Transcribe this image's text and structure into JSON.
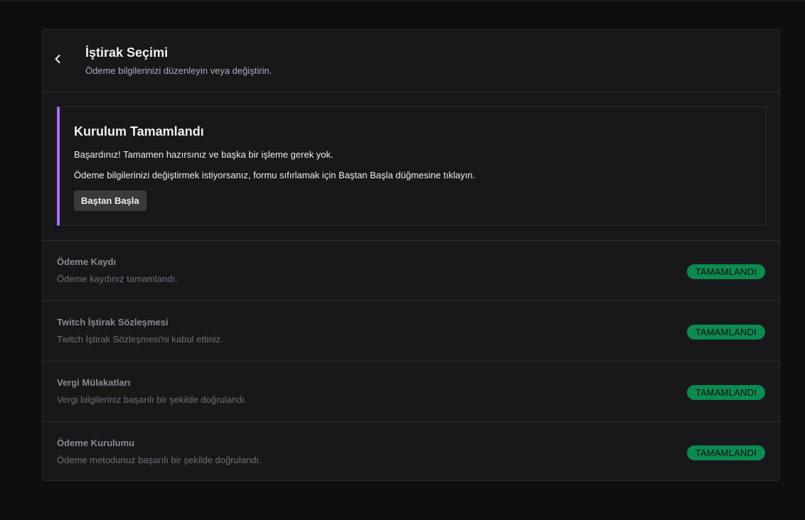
{
  "header": {
    "title": "İştirak Seçimi",
    "subtitle": "Ödeme bilgilerinizi düzenleyin veya değiştirin.",
    "back_icon": "chevron-left-icon"
  },
  "notice": {
    "title": "Kurulum Tamamlandı",
    "line1": "Başardınız! Tamamen hazırsınız ve başka bir işleme gerek yok.",
    "line2": "Ödeme bilgilerinizi değiştirmek istiyorsanız, formu sıfırlamak için Baştan Başla düğmesine tıklayın.",
    "button_label": "Baştan Başla",
    "accent_color": "#a970ff"
  },
  "steps": [
    {
      "title": "Ödeme Kaydı",
      "description": "Ödeme kaydınız tamamlandı.",
      "status": "TAMAMLANDI"
    },
    {
      "title": "Twitch İştirak Sözleşmesi",
      "description": "Twitch İştirak Sözleşmesi'ni kabul ettiniz.",
      "status": "TAMAMLANDI"
    },
    {
      "title": "Vergi Mülakatları",
      "description": "Vergi bilgileriniz başarılı bir şekilde doğrulandı.",
      "status": "TAMAMLANDI"
    },
    {
      "title": "Ödeme Kurulumu",
      "description": "Ödeme metodunuz başarılı bir şekilde doğrulandı.",
      "status": "TAMAMLANDI"
    }
  ],
  "colors": {
    "status_badge": "#0c8a50",
    "background": "#0e0e10",
    "panel": "#18181b"
  }
}
